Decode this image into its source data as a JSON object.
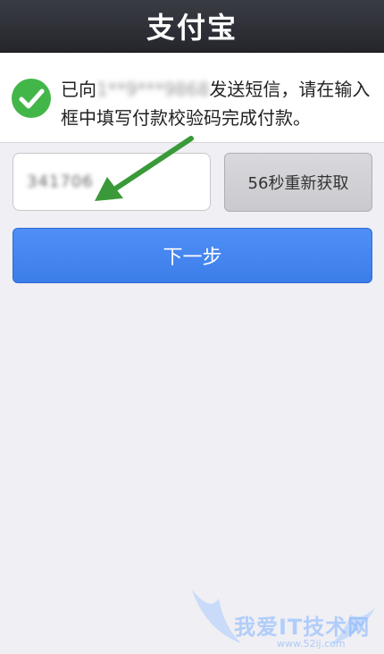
{
  "app": {
    "logo_text": "支付宝"
  },
  "notice": {
    "prefix": "已向",
    "masked_phone": "1**9***9868",
    "suffix": "发送短信，请在输入框中填写付款校验码完成付款。"
  },
  "code_input": {
    "value": "341706"
  },
  "resend_button": {
    "label": "56秒重新获取"
  },
  "next_button": {
    "label": "下一步"
  },
  "watermark": {
    "main": "我爱IT技术网",
    "sub": "www.52ij.com"
  },
  "colors": {
    "header": "#2b2d33",
    "check_green": "#43b649",
    "primary_blue": "#4285f4",
    "arrow_green": "#3a9a3a"
  }
}
